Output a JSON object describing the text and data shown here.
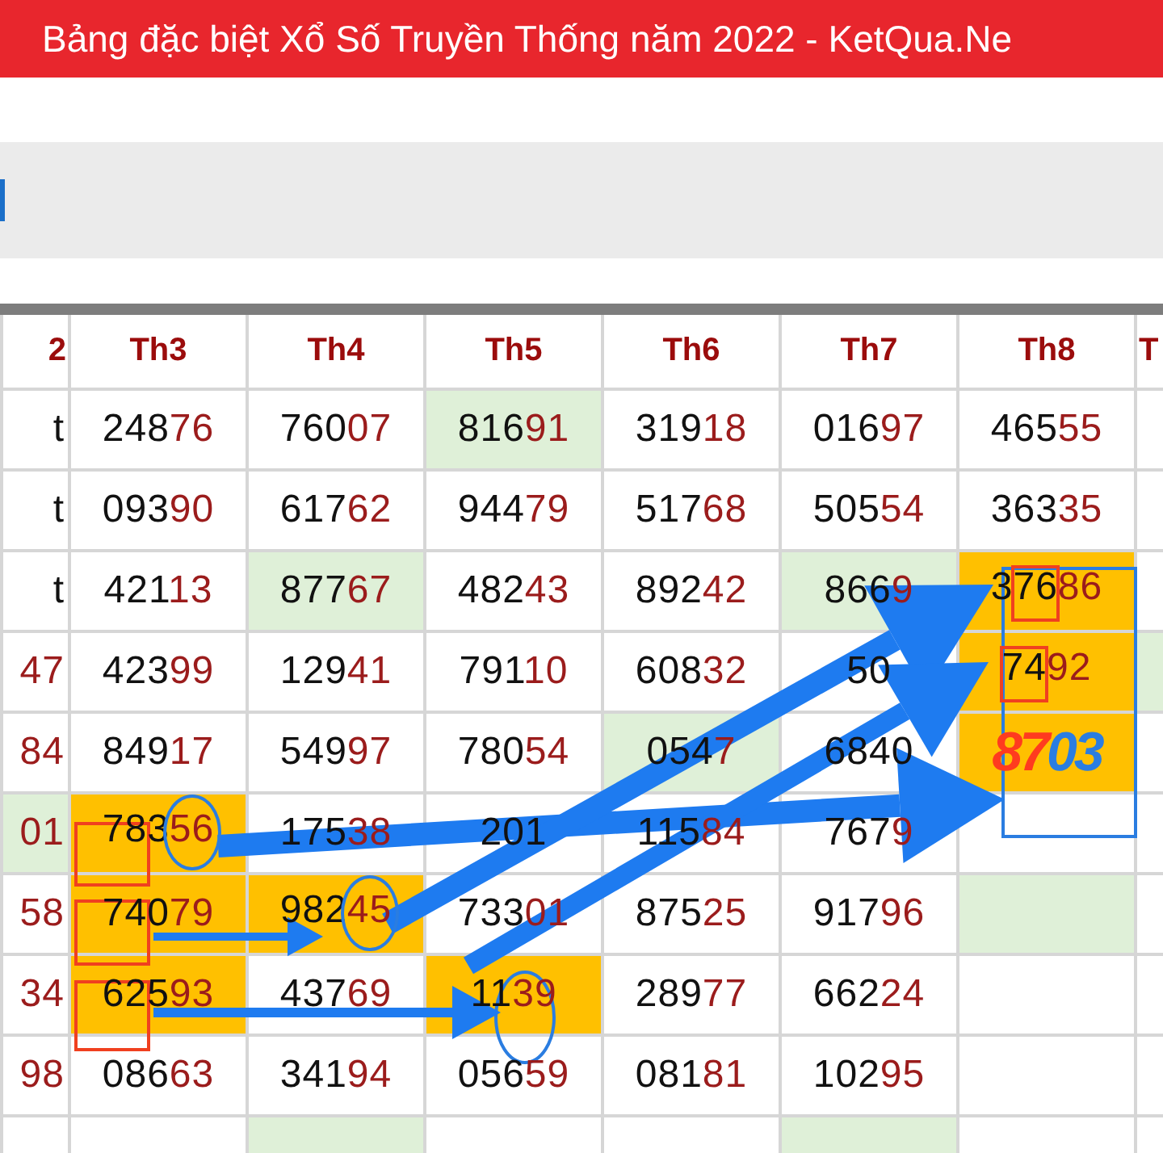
{
  "header": {
    "title": "Bảng đặc biệt Xổ Số Truyền Thống năm 2022 - KetQua.Ne"
  },
  "table": {
    "columns": [
      "2",
      "Th3",
      "Th4",
      "Th5",
      "Th6",
      "Th7",
      "Th8",
      "T"
    ],
    "rows": [
      {
        "cells": [
          {
            "kind": "number",
            "head": "t"
          },
          {
            "kind": "number",
            "head": "248",
            "tail": "76"
          },
          {
            "kind": "number",
            "head": "760",
            "tail": "07"
          },
          {
            "kind": "number",
            "head": "816",
            "tail": "91",
            "color": "#dff0d8"
          },
          {
            "kind": "number",
            "head": "319",
            "tail": "18"
          },
          {
            "kind": "number",
            "head": "016",
            "tail": "97"
          },
          {
            "kind": "number",
            "head": "465",
            "tail": "55"
          },
          {
            "kind": "number"
          }
        ]
      },
      {
        "cells": [
          {
            "kind": "number",
            "head": "t"
          },
          {
            "kind": "number",
            "head": "093",
            "tail": "90"
          },
          {
            "kind": "number",
            "head": "617",
            "tail": "62"
          },
          {
            "kind": "number",
            "head": "944",
            "tail": "79"
          },
          {
            "kind": "number",
            "head": "517",
            "tail": "68"
          },
          {
            "kind": "number",
            "head": "505",
            "tail": "54"
          },
          {
            "kind": "number",
            "head": "363",
            "tail": "35"
          },
          {
            "kind": "number"
          }
        ]
      },
      {
        "cells": [
          {
            "kind": "number",
            "head": "t"
          },
          {
            "kind": "number",
            "head": "421",
            "tail": "13"
          },
          {
            "kind": "number",
            "head": "877",
            "tail": "67",
            "color": "#dff0d8"
          },
          {
            "kind": "number",
            "head": "482",
            "tail": "43"
          },
          {
            "kind": "number",
            "head": "892",
            "tail": "42"
          },
          {
            "kind": "number",
            "head": "866",
            "tail": "9",
            "color": "#dff0d8"
          },
          {
            "kind": "number",
            "head": "376",
            "tail": "86",
            "color": "#ffc000"
          },
          {
            "kind": "number"
          }
        ]
      },
      {
        "cells": [
          {
            "kind": "number",
            "tail": "47"
          },
          {
            "kind": "number",
            "head": "423",
            "tail": "99"
          },
          {
            "kind": "number",
            "head": "129",
            "tail": "41"
          },
          {
            "kind": "number",
            "head": "791",
            "tail": "10"
          },
          {
            "kind": "number",
            "head": "608",
            "tail": "32"
          },
          {
            "kind": "number",
            "head": "50"
          },
          {
            "kind": "number",
            "head": "74",
            "tail": "92",
            "color": "#ffc000"
          },
          {
            "kind": "number",
            "color": "#dff0d8"
          }
        ]
      },
      {
        "cells": [
          {
            "kind": "number",
            "tail": "84"
          },
          {
            "kind": "number",
            "head": "849",
            "tail": "17"
          },
          {
            "kind": "number",
            "head": "549",
            "tail": "97"
          },
          {
            "kind": "number",
            "head": "780",
            "tail": "54"
          },
          {
            "kind": "number",
            "head": "054",
            "tail": "7",
            "color": "#dff0d8"
          },
          {
            "kind": "number",
            "head": "6840"
          },
          {
            "kind": "handwritten",
            "marks": [
              {
                "text": "87",
                "color": "#ff3b1f"
              },
              {
                "text": "03",
                "color": "#2a7de1"
              }
            ],
            "color": "#ffc000"
          },
          {
            "kind": "number"
          }
        ]
      },
      {
        "cells": [
          {
            "kind": "number",
            "tail": "01",
            "color": "#dff0d8"
          },
          {
            "kind": "number",
            "head": "783",
            "tail": "56",
            "color": "#ffc000"
          },
          {
            "kind": "number",
            "head": "175",
            "tail": "38"
          },
          {
            "kind": "number",
            "head": "201"
          },
          {
            "kind": "number",
            "head": "115",
            "tail": "84"
          },
          {
            "kind": "number",
            "head": "767",
            "tail": "9"
          },
          {
            "kind": "number"
          },
          {
            "kind": "number"
          }
        ]
      },
      {
        "cells": [
          {
            "kind": "number",
            "tail": "58"
          },
          {
            "kind": "number",
            "head": "740",
            "tail": "79",
            "color": "#ffc000"
          },
          {
            "kind": "number",
            "head": "982",
            "tail": "45",
            "color": "#ffc000"
          },
          {
            "kind": "number",
            "head": "733",
            "tail": "01"
          },
          {
            "kind": "number",
            "head": "875",
            "tail": "25"
          },
          {
            "kind": "number",
            "head": "917",
            "tail": "96"
          },
          {
            "kind": "number",
            "color": "#dff0d8"
          },
          {
            "kind": "number"
          }
        ]
      },
      {
        "cells": [
          {
            "kind": "number",
            "tail": "34"
          },
          {
            "kind": "number",
            "head": "625",
            "tail": "93",
            "color": "#ffc000"
          },
          {
            "kind": "number",
            "head": "437",
            "tail": "69"
          },
          {
            "kind": "number",
            "head": "11",
            "tail": "39",
            "color": "#ffc000"
          },
          {
            "kind": "number",
            "head": "289",
            "tail": "77"
          },
          {
            "kind": "number",
            "head": "662",
            "tail": "24"
          },
          {
            "kind": "number"
          },
          {
            "kind": "number"
          }
        ]
      },
      {
        "cells": [
          {
            "kind": "number",
            "tail": "98"
          },
          {
            "kind": "number",
            "head": "086",
            "tail": "63"
          },
          {
            "kind": "number",
            "head": "341",
            "tail": "94"
          },
          {
            "kind": "number",
            "head": "056",
            "tail": "59"
          },
          {
            "kind": "number",
            "head": "081",
            "tail": "81"
          },
          {
            "kind": "number",
            "head": "102",
            "tail": "95"
          },
          {
            "kind": "number"
          },
          {
            "kind": "number"
          }
        ]
      },
      {
        "cells": [
          {
            "kind": "number"
          },
          {
            "kind": "number"
          },
          {
            "kind": "number",
            "color": "#dff0d8"
          },
          {
            "kind": "number"
          },
          {
            "kind": "number"
          },
          {
            "kind": "number",
            "color": "#dff0d8"
          },
          {
            "kind": "number"
          },
          {
            "kind": "number"
          }
        ]
      }
    ]
  }
}
